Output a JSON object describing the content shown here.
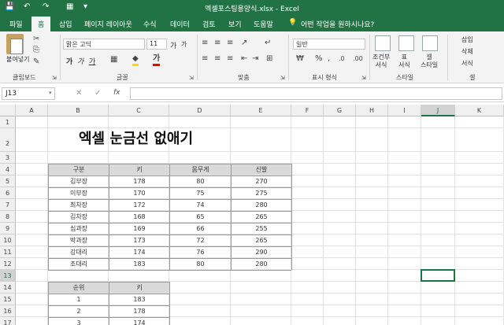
{
  "titlebar": {
    "title": "엑셀포스팅용양식.xlsx - Excel"
  },
  "tabs": [
    "파일",
    "홈",
    "삽입",
    "페이지 레이아웃",
    "수식",
    "데이터",
    "검토",
    "보기",
    "도움말"
  ],
  "tell_me": "어떤 작업을 원하시나요?",
  "ribbon": {
    "clipboard": {
      "paste": "붙여넣기",
      "label": "클립보드"
    },
    "font": {
      "name": "맑은 고딕",
      "size": "11",
      "bold": "가",
      "italic": "가",
      "underline": "가",
      "grow": "가",
      "shrink": "가",
      "label": "글꼴"
    },
    "align": {
      "label": "맞춤"
    },
    "number": {
      "format": "일반",
      "label": "표시 형식"
    },
    "styles": {
      "cond": "조건부\n서식",
      "table": "표\n서식",
      "cellstyle": "셀\n스타일",
      "label": "스타일"
    },
    "cells": {
      "insert": "삽입",
      "delete": "삭제",
      "format": "서식",
      "label": "셀"
    }
  },
  "formula": {
    "namebox": "J13",
    "fx": "fx"
  },
  "columns": [
    "A",
    "B",
    "C",
    "D",
    "E",
    "F",
    "G",
    "H",
    "I",
    "J",
    "K"
  ],
  "rows": [
    "1",
    "2",
    "3",
    "4",
    "5",
    "6",
    "7",
    "8",
    "9",
    "10",
    "11",
    "12",
    "13",
    "14",
    "15",
    "16",
    "17"
  ],
  "sheet_title": "엑셀 눈금선 없애기",
  "table1": {
    "headers": [
      "구분",
      "키",
      "몸무게",
      "신발"
    ],
    "rows": [
      [
        "김부장",
        "178",
        "80",
        "270"
      ],
      [
        "이부장",
        "170",
        "75",
        "275"
      ],
      [
        "최차장",
        "172",
        "74",
        "280"
      ],
      [
        "김차장",
        "168",
        "65",
        "265"
      ],
      [
        "심과장",
        "169",
        "66",
        "255"
      ],
      [
        "박과장",
        "173",
        "72",
        "265"
      ],
      [
        "강대리",
        "174",
        "76",
        "290"
      ],
      [
        "조대리",
        "183",
        "80",
        "280"
      ]
    ]
  },
  "table2": {
    "headers": [
      "순위",
      "키"
    ],
    "rows": [
      [
        "1",
        "183"
      ],
      [
        "2",
        "178"
      ],
      [
        "3",
        "174"
      ]
    ]
  }
}
